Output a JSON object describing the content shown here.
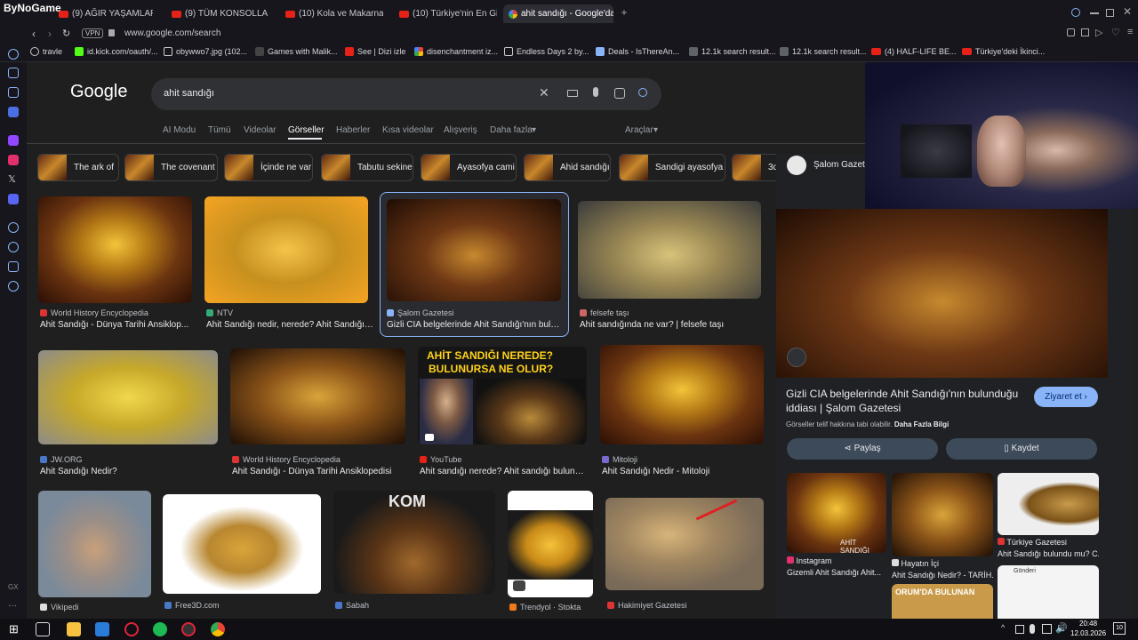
{
  "browser": {
    "logo": "ByNoGame",
    "tabs": [
      {
        "label": "(9) AĞIR YAŞAMLARIN EN",
        "icon": "youtube-icon"
      },
      {
        "label": "(9) TÜM KONSOLLARI DE",
        "icon": "youtube-icon"
      },
      {
        "label": "(10) Kola ve Makarna Aldı",
        "icon": "youtube-icon"
      },
      {
        "label": "(10) Türkiye'nin En Gizemi",
        "icon": "youtube-icon"
      },
      {
        "label": "ahit sandığı - Google'da A",
        "icon": "google-icon"
      }
    ],
    "vpn": "VPN",
    "url": "www.google.com/search",
    "bookmarks": [
      {
        "label": "travle",
        "color": "#5f6368"
      },
      {
        "label": "id.kick.com/oauth/...",
        "color": "#53fc18"
      },
      {
        "label": "obywwo7.jpg (102...",
        "color": "#8ab4f8"
      },
      {
        "label": "Games with Malik...",
        "color": "#e8eaed"
      },
      {
        "label": "See | Dizi izle",
        "color": "#e62117"
      },
      {
        "label": "disenchantment iz...",
        "color": "#4285f4"
      },
      {
        "label": "Endless Days 2 by...",
        "color": "#e8eaed"
      },
      {
        "label": "Deals - IsThereAn...",
        "color": "#8ab4f8"
      },
      {
        "label": "12.1k search result...",
        "color": "#5f6368"
      },
      {
        "label": "12.1k search result...",
        "color": "#5f6368"
      },
      {
        "label": "(4) HALF-LIFE BE...",
        "color": "#e62117"
      },
      {
        "label": "Türkiye'deki İkinci...",
        "color": "#e62117"
      }
    ]
  },
  "google": {
    "logo": "Google",
    "query": "ahit sandığı",
    "nav": [
      "AI Modu",
      "Tümü",
      "Videolar",
      "Görseller",
      "Haberler",
      "Kısa videolar",
      "Alışveriş",
      "Daha fazla"
    ],
    "tools": "Araçlar",
    "chips": [
      "The ark of",
      "The covenant",
      "İçinde ne var",
      "Tabutu sekine",
      "Ayasofya cami",
      "Ahid sandığı",
      "Sandigi ayasofya",
      "3d"
    ],
    "row1": [
      {
        "source": "World History Encyclopedia",
        "title": "Ahit Sandığı - Dünya Tarihi Ansiklop..."
      },
      {
        "source": "NTV",
        "title": "Ahit Sandığı nedir, nerede? Ahit Sandığı ..."
      },
      {
        "source": "Şalom Gazetesi",
        "title": "Gizli CIA belgelerinde Ahit Sandığı'nın bulu..."
      },
      {
        "source": "felsefe taşı",
        "title": "Ahit sandığında ne var? | felsefe taşı"
      }
    ],
    "row2": [
      {
        "source": "JW.ORG",
        "title": "Ahit Sandığı Nedir?"
      },
      {
        "source": "World History Encyclopedia",
        "title": "Ahit Sandığı - Dünya Tarihi Ansiklopedisi"
      },
      {
        "source": "YouTube",
        "title": "Ahit sandığı nerede? Ahit sandığı bulunur..."
      },
      {
        "source": "Mitoloji",
        "title": "Ahit Sandığı Nedir - Mitoloji"
      }
    ],
    "row3": [
      {
        "source": "Vikipedi"
      },
      {
        "source": "Free3D.com"
      },
      {
        "source": "Sabah"
      },
      {
        "source": "Trendyol · Stokta"
      },
      {
        "source": "Hakimiyet Gazetesi"
      }
    ],
    "thumb_texts": {
      "youtube_headline_1": "AHİT SANDIĞI NEREDE?",
      "youtube_headline_2": "BULUNURSA NE OLUR?",
      "kom": "KOM"
    }
  },
  "panel": {
    "source": "Şalom Gazetesi",
    "title": "Gizli CIA belgelerinde Ahit Sandığı'nın bulunduğu iddiası | Şalom Gazetesi",
    "visit": "Ziyaret et",
    "copyright": "Görseller telif hakkına tabi olabilir.",
    "more_info": "Daha Fazla Bilgi",
    "share": "Paylaş",
    "save": "Kaydet",
    "related": [
      {
        "source": "Instagram",
        "title": "Gizemli Ahit Sandığı Ahit...",
        "caption": "AHİT SANDIĞI"
      },
      {
        "source": "Hayatın İçi",
        "title": "Ahit Sandığı Nedir? - TARİH..."
      },
      {
        "source": "Türkiye Gazetesi",
        "title": "Ahit Sandığı bulundu mu? C..."
      }
    ],
    "related2": [
      {
        "caption": "ORUM'DA BULUNAN"
      },
      {
        "caption": "Gönderi"
      }
    ]
  },
  "taskbar": {
    "time": "20:48",
    "date": "12.03.2026",
    "notifications": "10"
  }
}
